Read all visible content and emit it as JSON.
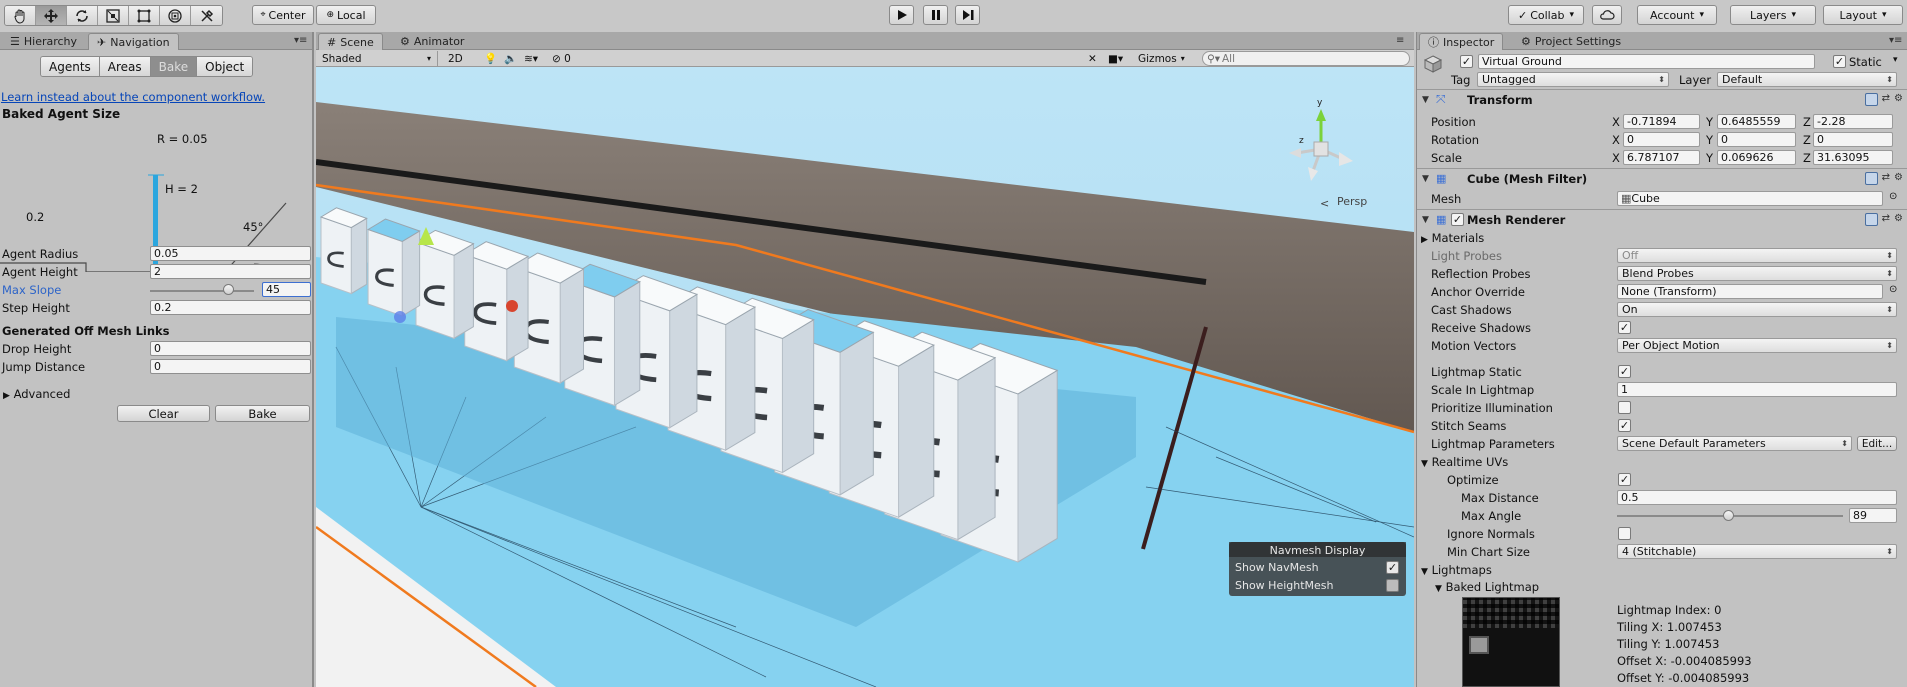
{
  "toolbar": {
    "tools": [
      "hand-tool",
      "move-tool",
      "rotate-tool",
      "scale-tool",
      "rect-tool",
      "transform-tool",
      "custom-tool"
    ],
    "pivot_mode": "Center",
    "pivot_rotation": "Local",
    "collab": "Collab",
    "account": "Account",
    "layers": "Layers",
    "layout": "Layout"
  },
  "left": {
    "tabs": [
      "Hierarchy",
      "Navigation"
    ],
    "nav_modes": [
      "Agents",
      "Areas",
      "Bake",
      "Object"
    ],
    "active_mode": "Bake",
    "learn_link": "Learn instead about the component workflow.",
    "baked_agent_size_title": "Baked Agent Size",
    "diagram": {
      "radius_label": "R = 0.05",
      "height_label": "H = 2",
      "step_label": "0.2",
      "slope_label": "45°"
    },
    "fields": [
      {
        "label": "Agent Radius",
        "value": "0.05"
      },
      {
        "label": "Agent Height",
        "value": "2"
      },
      {
        "label": "Max Slope",
        "value": "45",
        "slider": 0.75
      },
      {
        "label": "Step Height",
        "value": "0.2"
      }
    ],
    "offmesh_title": "Generated Off Mesh Links",
    "offmesh_fields": [
      {
        "label": "Drop Height",
        "value": "0"
      },
      {
        "label": "Jump Distance",
        "value": "0"
      }
    ],
    "advanced": "Advanced",
    "clear_button": "Clear",
    "bake_button": "Bake"
  },
  "scene": {
    "tabs": [
      "Scene",
      "Animator"
    ],
    "shading": "Shaded",
    "mode_2d": "2D",
    "hidden_count": "0",
    "gizmos": "Gizmos",
    "search_placeholder": "All",
    "persp_label": "Persp",
    "navmesh_display": {
      "title": "Navmesh Display",
      "show_navmesh": "Show NavMesh",
      "show_navmesh_checked": true,
      "show_heightmesh": "Show HeightMesh",
      "show_heightmesh_checked": false
    }
  },
  "inspector": {
    "tabs": [
      "Inspector",
      "Project Settings"
    ],
    "object_name": "Virtual Ground",
    "static_label": "Static",
    "tag_label": "Tag",
    "tag_value": "Untagged",
    "layer_label": "Layer",
    "layer_value": "Default",
    "transform": {
      "title": "Transform",
      "position": {
        "label": "Position",
        "x": "-0.71894",
        "y": "0.6485559",
        "z": "-2.28"
      },
      "rotation": {
        "label": "Rotation",
        "x": "0",
        "y": "0",
        "z": "0"
      },
      "scale": {
        "label": "Scale",
        "x": "6.787107",
        "y": "0.069626",
        "z": "31.63095"
      }
    },
    "mesh_filter": {
      "title": "Cube (Mesh Filter)",
      "mesh_label": "Mesh",
      "mesh_value": "Cube"
    },
    "mesh_renderer": {
      "title": "Mesh Renderer",
      "materials": "Materials",
      "light_probes": {
        "label": "Light Probes",
        "value": "Off"
      },
      "reflection_probes": {
        "label": "Reflection Probes",
        "value": "Blend Probes"
      },
      "anchor_override": {
        "label": "Anchor Override",
        "value": "None (Transform)"
      },
      "cast_shadows": {
        "label": "Cast Shadows",
        "value": "On"
      },
      "receive_shadows": {
        "label": "Receive Shadows",
        "checked": true
      },
      "motion_vectors": {
        "label": "Motion Vectors",
        "value": "Per Object Motion"
      },
      "lightmap_static": {
        "label": "Lightmap Static",
        "checked": true
      },
      "scale_in_lightmap": {
        "label": "Scale In Lightmap",
        "value": "1"
      },
      "prioritize_illumination": {
        "label": "Prioritize Illumination",
        "checked": false
      },
      "stitch_seams": {
        "label": "Stitch Seams",
        "checked": true
      },
      "lightmap_parameters": {
        "label": "Lightmap Parameters",
        "value": "Scene Default Parameters",
        "edit": "Edit..."
      },
      "realtime_uvs": "Realtime UVs",
      "optimize": {
        "label": "Optimize",
        "checked": true
      },
      "max_distance": {
        "label": "Max Distance",
        "value": "0.5"
      },
      "max_angle": {
        "label": "Max Angle",
        "value": "89",
        "slider": 0.49
      },
      "ignore_normals": {
        "label": "Ignore Normals",
        "checked": false
      },
      "min_chart_size": {
        "label": "Min Chart Size",
        "value": "4 (Stitchable)"
      },
      "lightmaps": "Lightmaps",
      "baked_lightmap": "Baked Lightmap",
      "lightmap_info": [
        "Lightmap Index: 0",
        "Tiling X: 1.007453",
        "Tiling Y: 1.007453",
        "Offset X: -0.004085993",
        "Offset Y: -0.004085993"
      ]
    }
  },
  "colors": {
    "navmesh": "#86d2f0",
    "sky": "#b7e1f4",
    "ground": "#6f655d",
    "selection_outline": "#f07a1e",
    "link": "#0645b8"
  }
}
